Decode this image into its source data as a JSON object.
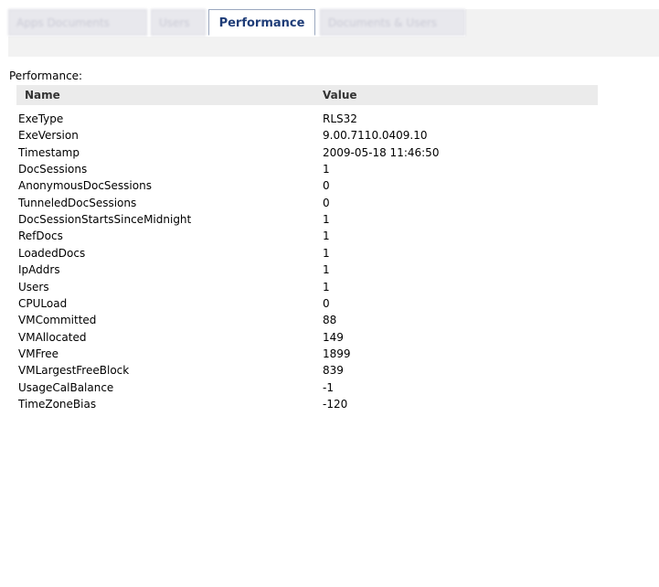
{
  "tabs": [
    {
      "label": "Apps Documents",
      "active": false
    },
    {
      "label": "Users",
      "active": false
    },
    {
      "label": "Performance",
      "active": true
    },
    {
      "label": "Documents & Users",
      "active": false
    }
  ],
  "section_title": "Performance:",
  "table": {
    "headers": [
      "Name",
      "Value"
    ],
    "rows": [
      {
        "name": "ExeType",
        "value": "RLS32"
      },
      {
        "name": "ExeVersion",
        "value": "9.00.7110.0409.10"
      },
      {
        "name": "Timestamp",
        "value": "2009-05-18 11:46:50"
      },
      {
        "name": "DocSessions",
        "value": "1"
      },
      {
        "name": "AnonymousDocSessions",
        "value": "0"
      },
      {
        "name": "TunneledDocSessions",
        "value": "0"
      },
      {
        "name": "DocSessionStartsSinceMidnight",
        "value": "1"
      },
      {
        "name": "RefDocs",
        "value": "1"
      },
      {
        "name": "LoadedDocs",
        "value": "1"
      },
      {
        "name": "IpAddrs",
        "value": "1"
      },
      {
        "name": "Users",
        "value": "1"
      },
      {
        "name": "CPULoad",
        "value": "0"
      },
      {
        "name": "VMCommitted",
        "value": "88"
      },
      {
        "name": "VMAllocated",
        "value": "149"
      },
      {
        "name": "VMFree",
        "value": "1899"
      },
      {
        "name": "VMLargestFreeBlock",
        "value": "839"
      },
      {
        "name": "UsageCalBalance",
        "value": "-1"
      },
      {
        "name": "TimeZoneBias",
        "value": "-120"
      }
    ]
  }
}
